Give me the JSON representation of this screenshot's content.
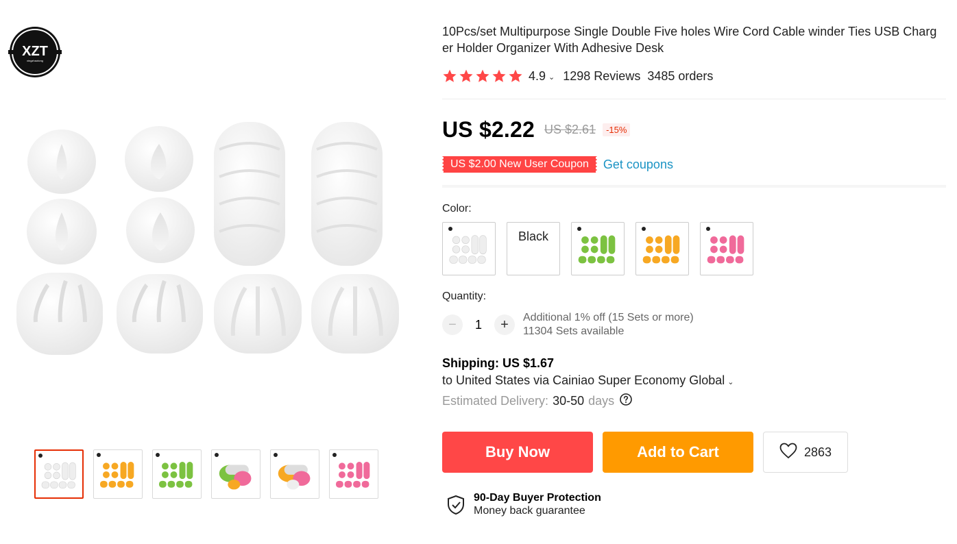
{
  "store": {
    "logo_text": "XZT",
    "logo_subtext": "xingzhaotong"
  },
  "product": {
    "title": "10Pcs/set Multipurpose Single Double Five holes Wire Cord Cable winder Ties USB Charger Holder Organizer With Adhesive Desk",
    "rating": "4.9",
    "reviews": "1298 Reviews",
    "orders": "3485 orders",
    "stars": 5,
    "star_color": "#ff4747"
  },
  "pricing": {
    "price": "US $2.22",
    "old_price": "US $2.61",
    "discount": "-15%",
    "coupon": "US $2.00 New User Coupon",
    "get_coupons": "Get coupons"
  },
  "color": {
    "label": "Color:",
    "options": [
      {
        "type": "image",
        "tint": "#eeeeee"
      },
      {
        "type": "text",
        "label": "Black"
      },
      {
        "type": "image",
        "tint": "#7cc241"
      },
      {
        "type": "image",
        "tint": "#f7a823"
      },
      {
        "type": "image",
        "tint": "#f06a9a"
      }
    ]
  },
  "quantity": {
    "label": "Quantity:",
    "value": "1",
    "minus": "−",
    "plus": "+",
    "note_discount": "Additional 1% off (15 Sets or more)",
    "note_available": "11304 Sets available"
  },
  "shipping": {
    "title": "Shipping: US $1.67",
    "via": "to United States via Cainiao Super Economy Global",
    "estimated_label": "Estimated Delivery:",
    "estimated_days": "30-50",
    "days_unit": "days"
  },
  "actions": {
    "buy_now": "Buy Now",
    "add_to_cart": "Add to Cart",
    "wishlist_count": "2863"
  },
  "protection": {
    "title": "90-Day Buyer Protection",
    "subtitle": "Money back guarantee"
  },
  "gallery": {
    "thumbnails": [
      {
        "variant": "grid",
        "tint": "#eeeeee"
      },
      {
        "variant": "grid",
        "tint": "#f7a823"
      },
      {
        "variant": "grid",
        "tint": "#7cc241"
      },
      {
        "variant": "mixed",
        "tint": "#7cc241"
      },
      {
        "variant": "mixed",
        "tint": "#f7a823"
      },
      {
        "variant": "grid",
        "tint": "#f06a9a"
      }
    ]
  },
  "colors": {
    "accent": "#ff4747",
    "cart": "#ff9a00",
    "link": "#1a93c4"
  }
}
